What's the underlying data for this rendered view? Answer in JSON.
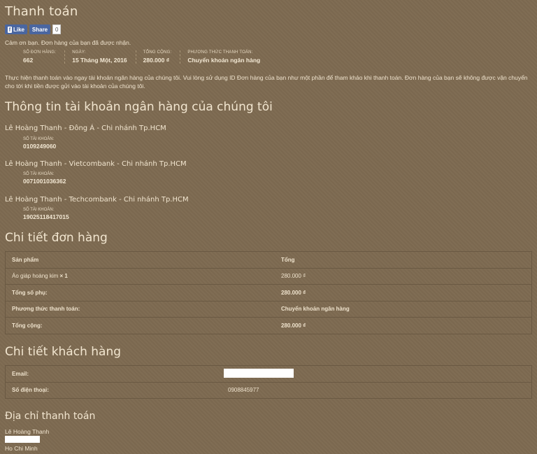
{
  "page": {
    "title": "Thanh toán"
  },
  "social": {
    "like_label": "Like",
    "share_label": "Share",
    "share_count": "0"
  },
  "thanks": "Cảm ơn bạn. Đơn hàng của bạn đã được nhận.",
  "overview": [
    {
      "label": "Số đơn hàng:",
      "value": "662"
    },
    {
      "label": "Ngày:",
      "value": "15 Tháng Một, 2016"
    },
    {
      "label": "Tổng cộng:",
      "value": "280.000 ₫"
    },
    {
      "label": "Phương thức thanh toán:",
      "value": "Chuyển khoản ngân hàng"
    }
  ],
  "instructions": "Thực hiện thanh toán vào ngay tài khoản ngân hàng của chúng tôi. Vui lòng sử dụng ID Đơn hàng của bạn như một phần để tham khảo khi thanh toán. Đơn hàng của bạn sẽ không được vận chuyển cho tới khi tiền được gửi vào tài khoản của chúng tôi.",
  "bank_section": {
    "title": "Thông tin tài khoản ngân hàng của chúng tôi",
    "accounts": [
      {
        "name": "Lê Hoàng Thanh - Đông Á - Chi nhánh Tp.HCM",
        "label": "Số tài khoản:",
        "number": "0109249060"
      },
      {
        "name": "Lê Hoàng Thanh - Vietcombank - Chi nhánh Tp.HCM",
        "label": "Số tài khoản:",
        "number": "0071001036362"
      },
      {
        "name": "Lê Hoàng Thanh - Techcombank - Chi nhánh Tp.HCM",
        "label": "Số tài khoản:",
        "number": "19025118417015"
      }
    ]
  },
  "order_details": {
    "title": "Chi tiết đơn hàng",
    "headers": [
      "Sản phẩm",
      "Tổng"
    ],
    "item": {
      "name": "Áo giáp hoàng kim",
      "qty": "× 1",
      "total": "280.000 ₫"
    },
    "rows": [
      {
        "label": "Tổng số phụ:",
        "value": "280.000 ₫"
      },
      {
        "label": "Phương thức thanh toán:",
        "value": "Chuyển khoản ngân hàng"
      },
      {
        "label": "Tổng cộng:",
        "value": "280.000 ₫"
      }
    ]
  },
  "customer": {
    "title": "Chi tiết khách hàng",
    "email_label": "Email:",
    "phone_label": "Số điện thoại:",
    "phone": "0908845977"
  },
  "billing": {
    "title": "Địa chỉ thanh toán",
    "name": "Lê Hoàng Thanh",
    "city": "Ho Chi Minh"
  },
  "colors": {
    "background": "#7d6a51",
    "text": "#f1e6d2",
    "facebook": "#4a66a0"
  }
}
